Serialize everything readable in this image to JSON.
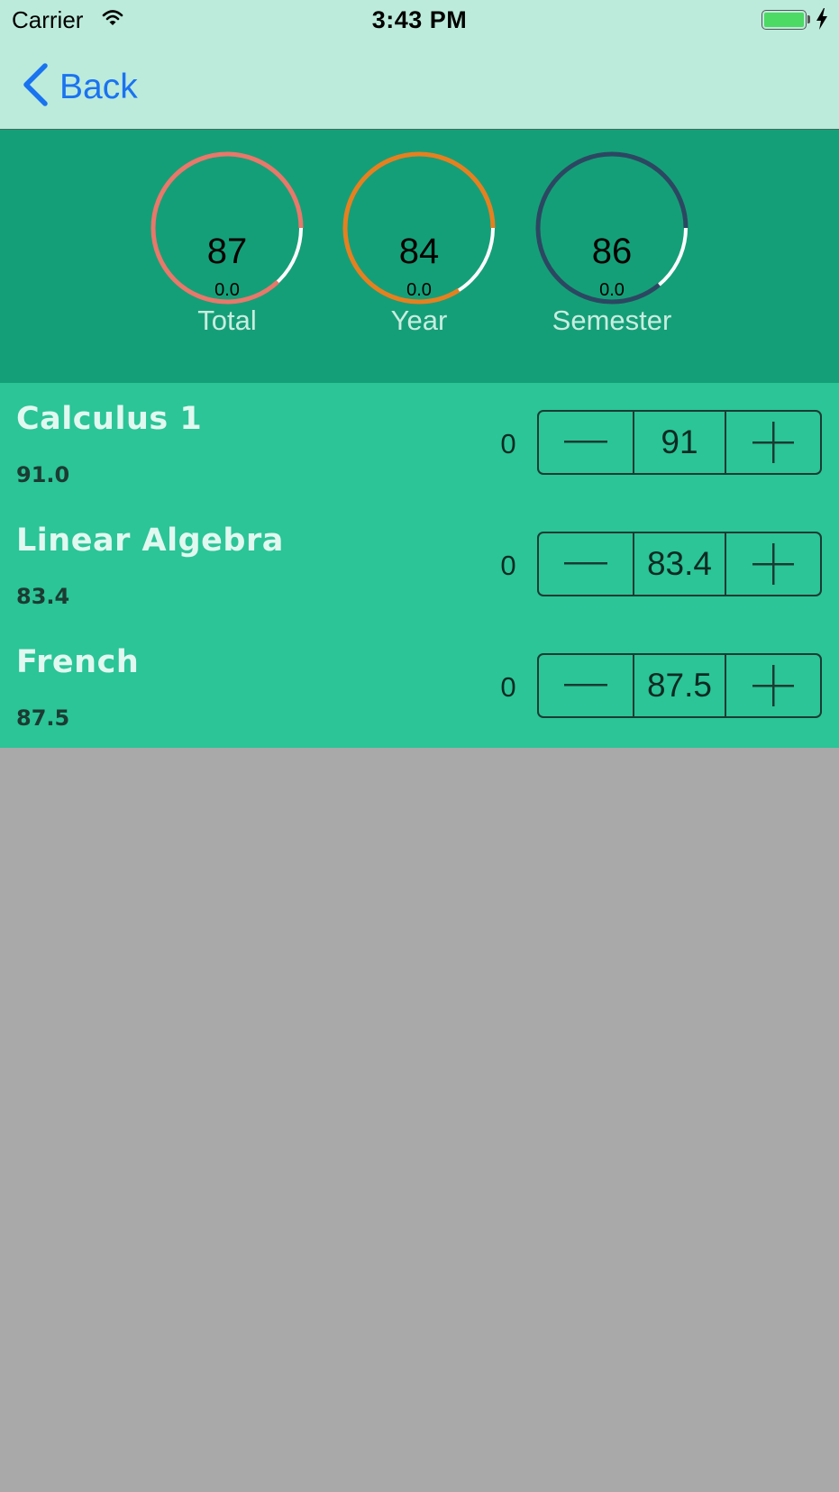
{
  "status_bar": {
    "carrier": "Carrier",
    "time": "3:43 PM",
    "battery_color": "#4cd964"
  },
  "nav": {
    "back_label": "Back",
    "accent": "#1a73f0"
  },
  "rings": [
    {
      "value": "87",
      "sub": "0.0",
      "label": "Total",
      "color": "#e9776a",
      "fill": 0.87
    },
    {
      "value": "84",
      "sub": "0.0",
      "label": "Year",
      "color": "#e6801f",
      "fill": 0.84
    },
    {
      "value": "86",
      "sub": "0.0",
      "label": "Semester",
      "color": "#2c4762",
      "fill": 0.86
    }
  ],
  "courses": [
    {
      "name": "Calculus 1",
      "grade": "91.0",
      "count": "0",
      "stepper_value": "91"
    },
    {
      "name": "Linear Algebra",
      "grade": "83.4",
      "count": "0",
      "stepper_value": "83.4"
    },
    {
      "name": "French",
      "grade": "87.5",
      "count": "0",
      "stepper_value": "87.5"
    }
  ],
  "colors": {
    "header_bg": "#bcebdb",
    "rings_bg": "#159f78",
    "list_bg": "#2bc597",
    "empty_bg": "#a9a9a9"
  }
}
